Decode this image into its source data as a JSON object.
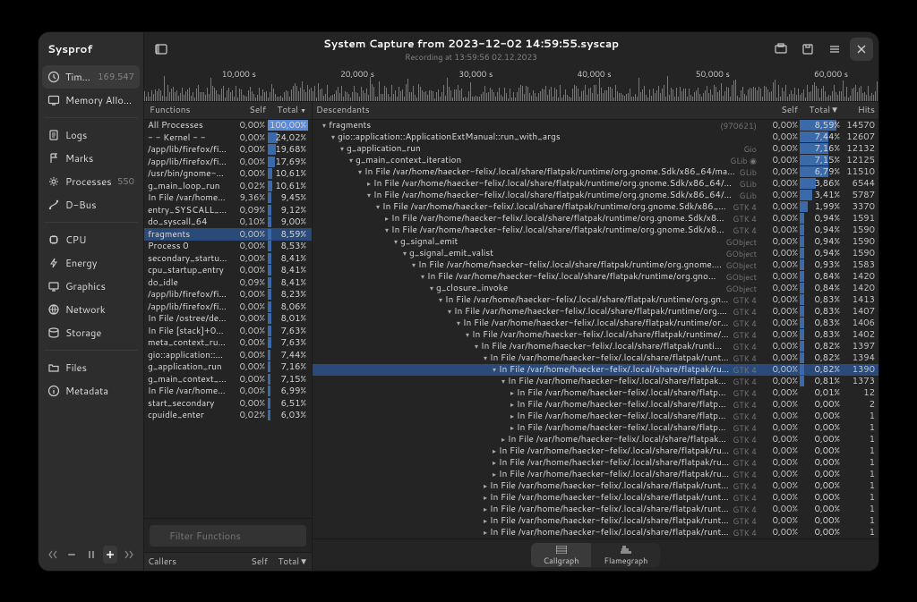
{
  "app": {
    "title": "Sysprof"
  },
  "header": {
    "title": "System Capture from 2023-12-02 14:59:55.syscap",
    "subtitle": "Recording at 13:59:56 02.12.2023"
  },
  "sidebar": {
    "groups": [
      [
        {
          "icon": "clock",
          "label": "Time Profiler",
          "count": "169.547",
          "active": true
        },
        {
          "icon": "screen",
          "label": "Memory Allocations"
        }
      ],
      [
        {
          "icon": "doc",
          "label": "Logs"
        },
        {
          "icon": "flag",
          "label": "Marks"
        },
        {
          "icon": "gear",
          "label": "Processes",
          "count": "550"
        },
        {
          "icon": "wire",
          "label": "D-Bus"
        }
      ],
      [
        {
          "icon": "chip",
          "label": "CPU"
        },
        {
          "icon": "bolt",
          "label": "Energy"
        },
        {
          "icon": "display",
          "label": "Graphics"
        },
        {
          "icon": "net",
          "label": "Network"
        },
        {
          "icon": "disk",
          "label": "Storage"
        }
      ],
      [
        {
          "icon": "folder",
          "label": "Files"
        },
        {
          "icon": "info",
          "label": "Metadata"
        }
      ]
    ]
  },
  "timeline": {
    "ticks": [
      "10,000 s",
      "20,000 s",
      "30,000 s",
      "40,000 s",
      "50,000 s",
      "60,000 s"
    ]
  },
  "functions": {
    "headers": {
      "func": "Functions",
      "self": "Self",
      "total": "Total"
    },
    "rows": [
      {
        "name": "All Processes",
        "self": "0,00%",
        "total": "100,00%",
        "bar": 100,
        "top": true
      },
      {
        "name": "- - Kernel - -",
        "self": "0,00%",
        "total": "24,02%",
        "bar": 24
      },
      {
        "name": "/app/lib/firefox/firefo",
        "self": "0,00%",
        "total": "19,68%",
        "bar": 20
      },
      {
        "name": "/app/lib/firefox/firefo",
        "self": "0,00%",
        "total": "17,69%",
        "bar": 18
      },
      {
        "name": "/usr/bin/gnome-shell",
        "self": "0,00%",
        "total": "10,61%",
        "bar": 11
      },
      {
        "name": "g_main_loop_run",
        "self": "0,02%",
        "total": "10,61%",
        "bar": 11
      },
      {
        "name": "In File /var/home/hae",
        "self": "9,36%",
        "total": "9,45%",
        "bar": 9
      },
      {
        "name": "entry_SYSCALL_64_a",
        "self": "0,09%",
        "total": "9,12%",
        "bar": 9
      },
      {
        "name": "do_syscall_64",
        "self": "0,10%",
        "total": "9,00%",
        "bar": 9
      },
      {
        "name": "fragments",
        "self": "0,00%",
        "total": "8,59%",
        "bar": 9,
        "sel": true
      },
      {
        "name": "Process 0",
        "self": "0,00%",
        "total": "8,53%",
        "bar": 9
      },
      {
        "name": "secondary_startup_6",
        "self": "0,00%",
        "total": "8,41%",
        "bar": 8
      },
      {
        "name": "cpu_startup_entry",
        "self": "0,00%",
        "total": "8,41%",
        "bar": 8
      },
      {
        "name": "do_idle",
        "self": "0,09%",
        "total": "8,41%",
        "bar": 8
      },
      {
        "name": "/app/lib/firefox/firefo",
        "self": "0,00%",
        "total": "8,23%",
        "bar": 8
      },
      {
        "name": "/app/lib/firefox/firefo",
        "self": "0,00%",
        "total": "8,06%",
        "bar": 8
      },
      {
        "name": "In File /ostree/deploy",
        "self": "0,00%",
        "total": "8,01%",
        "bar": 8
      },
      {
        "name": "In File [stack]+0x4b1",
        "self": "0,00%",
        "total": "7,63%",
        "bar": 8
      },
      {
        "name": "meta_context_run_m",
        "self": "0,00%",
        "total": "7,63%",
        "bar": 8
      },
      {
        "name": "gio::application::Appl",
        "self": "0,00%",
        "total": "7,44%",
        "bar": 7
      },
      {
        "name": "g_application_run",
        "self": "0,00%",
        "total": "7,16%",
        "bar": 7
      },
      {
        "name": "g_main_context_iterz",
        "self": "0,00%",
        "total": "7,15%",
        "bar": 7
      },
      {
        "name": "In File /var/home/hae",
        "self": "0,00%",
        "total": "6,99%",
        "bar": 7
      },
      {
        "name": "start_secondary",
        "self": "0,00%",
        "total": "6,51%",
        "bar": 7
      },
      {
        "name": "cpuidle_enter",
        "self": "0,02%",
        "total": "6,03%",
        "bar": 6
      }
    ],
    "filter_placeholder": "Filter Functions",
    "callers": {
      "label": "Callers",
      "self": "Self",
      "total": "Total"
    }
  },
  "descendants": {
    "header": {
      "label": "Descendants",
      "self": "Self",
      "total": "Total",
      "hits": "Hits"
    },
    "rows": [
      {
        "d": 0,
        "a": "▾",
        "name": "fragments",
        "count": "(970621)",
        "self": "0,00%",
        "total": "8,59%",
        "hits": "14570",
        "bar": 9
      },
      {
        "d": 1,
        "a": "▾",
        "name": "gio::application::ApplicationExtManual::run_with_args",
        "self": "0,00%",
        "total": "7,44%",
        "hits": "12607",
        "bar": 7
      },
      {
        "d": 2,
        "a": "▾",
        "name": "g_application_run",
        "tag": "Gio",
        "self": "0,00%",
        "total": "7,16%",
        "hits": "12132",
        "bar": 7
      },
      {
        "d": 3,
        "a": "▾",
        "name": "g_main_context_iteration",
        "tag": "GLib ◉",
        "self": "0,00%",
        "total": "7,15%",
        "hits": "12125",
        "bar": 7
      },
      {
        "d": 4,
        "a": "▾",
        "name": "In File /var/home/haecker-felix/.local/share/flatpak/runtime/org.gnome.Sdk/x86_64/master/044418064",
        "tag": "GLib",
        "self": "0,00%",
        "total": "6,79%",
        "hits": "11510",
        "bar": 7
      },
      {
        "d": 5,
        "a": "▸",
        "name": "In File /var/home/haecker-felix/.local/share/flatpak/runtime/org.gnome.Sdk/x86_64/master/04441806",
        "tag": "GLib",
        "self": "0,00%",
        "total": "3,86%",
        "hits": "6544",
        "bar": 4
      },
      {
        "d": 5,
        "a": "▾",
        "name": "In File /var/home/haecker-felix/.local/share/flatpak/runtime/org.gnome.Sdk/x86_64/master/04441806",
        "tag": "GLib",
        "self": "0,00%",
        "total": "3,41%",
        "hits": "5787",
        "bar": 3
      },
      {
        "d": 6,
        "a": "▾",
        "name": "In File /var/home/haecker-felix/.local/share/flatpak/runtime/org.gnome.Sdk/x86_64/master/0444",
        "tag": "GTK 4",
        "self": "0,00%",
        "total": "1,99%",
        "hits": "3370",
        "bar": 2
      },
      {
        "d": 7,
        "a": "▸",
        "name": "In File /var/home/haecker-felix/.local/share/flatpak/runtime/org.gnome.Sdk/x86_64/master/04",
        "tag": "GTK 4",
        "self": "0,00%",
        "total": "0,94%",
        "hits": "1591",
        "bar": 1
      },
      {
        "d": 7,
        "a": "▾",
        "name": "In File /var/home/haecker-felix/.local/share/flatpak/runtime/org.gnome.Sdk/x86_64/master/0",
        "tag": "GTK 4",
        "self": "0,00%",
        "total": "0,94%",
        "hits": "1590",
        "bar": 1
      },
      {
        "d": 8,
        "a": "▾",
        "name": "g_signal_emit",
        "tag": "GObject",
        "self": "0,00%",
        "total": "0,94%",
        "hits": "1590",
        "bar": 1
      },
      {
        "d": 9,
        "a": "▾",
        "name": "g_signal_emit_valist",
        "tag": "GObject",
        "self": "0,00%",
        "total": "0,94%",
        "hits": "1590",
        "bar": 1
      },
      {
        "d": 10,
        "a": "▾",
        "name": "In File /var/home/haecker-felix/.local/share/flatpak/runtime/org.gnome.Sdk/x86_64/m",
        "tag": "GObject",
        "self": "0,00%",
        "total": "0,93%",
        "hits": "1583",
        "bar": 1
      },
      {
        "d": 11,
        "a": "▾",
        "name": "In File /var/home/haecker-felix/.local/share/flatpak/runtime/org.gnome.Sdk/x86_64/",
        "tag": "GObject",
        "self": "0,00%",
        "total": "0,84%",
        "hits": "1420",
        "bar": 1
      },
      {
        "d": 12,
        "a": "▾",
        "name": "g_closure_invoke",
        "tag": "GObject",
        "self": "0,00%",
        "total": "0,84%",
        "hits": "1420",
        "bar": 1
      },
      {
        "d": 13,
        "a": "▾",
        "name": "In File /var/home/haecker-felix/.local/share/flatpak/runtime/org.gnome.Sdk/x86_64",
        "tag": "GTK 4",
        "self": "0,00%",
        "total": "0,83%",
        "hits": "1413",
        "bar": 1
      },
      {
        "d": 14,
        "a": "▾",
        "name": "In File /var/home/haecker-felix/.local/share/flatpak/runtime/org.gnome.Sdk/x86_",
        "tag": "GTK 4",
        "self": "0,00%",
        "total": "0,83%",
        "hits": "1407",
        "bar": 1
      },
      {
        "d": 15,
        "a": "▾",
        "name": "In File /var/home/haecker-felix/.local/share/flatpak/runtime/org.gnome.Sdk/x86",
        "tag": "GTK 4",
        "self": "0,00%",
        "total": "0,83%",
        "hits": "1406",
        "bar": 1
      },
      {
        "d": 16,
        "a": "▾",
        "name": "In File /var/home/haecker-felix/.local/share/flatpak/runtime/org.gnome.Sdk/x",
        "tag": "GTK 4",
        "self": "0,00%",
        "total": "0,83%",
        "hits": "1402",
        "bar": 1
      },
      {
        "d": 17,
        "a": "▾",
        "name": "In File /var/home/haecker-felix/.local/share/flatpak/runtime/org.gnome.Sdk",
        "tag": "GTK 4",
        "self": "0,00%",
        "total": "0,82%",
        "hits": "1397",
        "bar": 1
      },
      {
        "d": 18,
        "a": "▾",
        "name": "In File /var/home/haecker-felix/.local/share/flatpak/runtime/org.gnome.Sdk",
        "tag": "GTK 4",
        "self": "0,00%",
        "total": "0,82%",
        "hits": "1394",
        "bar": 1
      },
      {
        "d": 19,
        "a": "▾",
        "name": "In File /var/home/haecker-felix/.local/share/flatpak/runtime/org.gnome.Sd",
        "tag": "GTK 4",
        "self": "0,00%",
        "total": "0,82%",
        "hits": "1390",
        "bar": 1,
        "sel": true
      },
      {
        "d": 20,
        "a": "▾",
        "name": "In File /var/home/haecker-felix/.local/share/flatpak/runtime/org.gnome.Sd",
        "tag": "GTK 4",
        "self": "0,00%",
        "total": "0,81%",
        "hits": "1373",
        "bar": 1
      },
      {
        "d": 21,
        "a": "▸",
        "name": "In File /var/home/haecker-felix/.local/share/flatpak/runtime/org.gnome.Sd",
        "tag": "GTK 4",
        "self": "0,00%",
        "total": "0,01%",
        "hits": "12",
        "bar": 0
      },
      {
        "d": 21,
        "a": "▸",
        "name": "In File /var/home/haecker-felix/.local/share/flatpak/runtime/org.gnome.Sd",
        "tag": "GTK 4",
        "self": "0,00%",
        "total": "0,00%",
        "hits": "2",
        "bar": 0
      },
      {
        "d": 21,
        "a": "▸",
        "name": "In File /var/home/haecker-felix/.local/share/flatpak/runtime/org.gnome.Sd",
        "tag": "GTK 4",
        "self": "0,00%",
        "total": "0,00%",
        "hits": "1",
        "bar": 0
      },
      {
        "d": 21,
        "a": "▸",
        "name": "In File /var/home/haecker-felix/.local/share/flatpak/runtime/org.gnome.Sd",
        "tag": "GTK 4",
        "self": "0,00%",
        "total": "0,00%",
        "hits": "1",
        "bar": 0
      },
      {
        "d": 20,
        "a": "▸",
        "name": "In File /var/home/haecker-felix/.local/share/flatpak/runtime/org.gnome.Sd",
        "tag": "GTK 4",
        "self": "0,00%",
        "total": "0,00%",
        "hits": "1",
        "bar": 0
      },
      {
        "d": 19,
        "a": "▸",
        "name": "In File /var/home/haecker-felix/.local/share/flatpak/runtime/org.gnome.Sd",
        "tag": "GTK 4",
        "self": "0,00%",
        "total": "0,00%",
        "hits": "1",
        "bar": 0
      },
      {
        "d": 19,
        "a": "▸",
        "name": "In File /var/home/haecker-felix/.local/share/flatpak/runtime/org.gnome.Sd",
        "tag": "GTK 4",
        "self": "0,00%",
        "total": "0,00%",
        "hits": "1",
        "bar": 0
      },
      {
        "d": 19,
        "a": "▸",
        "name": "In File /var/home/haecker-felix/.local/share/flatpak/runtime/org.gnome.Sd",
        "tag": "GTK 4",
        "self": "0,00%",
        "total": "0,00%",
        "hits": "1",
        "bar": 0
      },
      {
        "d": 18,
        "a": "▸",
        "name": "In File /var/home/haecker-felix/.local/share/flatpak/runtime/org.gnome.Sd",
        "tag": "GTK 4",
        "self": "0,00%",
        "total": "0,00%",
        "hits": "1",
        "bar": 0
      },
      {
        "d": 18,
        "a": "▸",
        "name": "In File /var/home/haecker-felix/.local/share/flatpak/runtime/org.gnome.Sd",
        "tag": "GTK 4",
        "self": "0,00%",
        "total": "0,00%",
        "hits": "1",
        "bar": 0
      },
      {
        "d": 18,
        "a": "▸",
        "name": "In File /var/home/haecker-felix/.local/share/flatpak/runtime/org.gnome.Sd",
        "tag": "GTK 4",
        "self": "0,00%",
        "total": "0,00%",
        "hits": "1",
        "bar": 0
      },
      {
        "d": 18,
        "a": "▸",
        "name": "In File /var/home/haecker-felix/.local/share/flatpak/runtime/org.gnome.Sd",
        "tag": "GTK 4",
        "self": "0,00%",
        "total": "0,00%",
        "hits": "1",
        "bar": 0
      },
      {
        "d": 18,
        "a": "▸",
        "name": "In File /var/home/haecker-felix/.local/share/flatpak/runtime/org.gnome.Sd",
        "tag": "GTK 4",
        "self": "0,00%",
        "total": "0,00%",
        "hits": "1",
        "bar": 0
      }
    ]
  },
  "switcher": {
    "a": "Callgraph",
    "b": "Flamegraph"
  }
}
